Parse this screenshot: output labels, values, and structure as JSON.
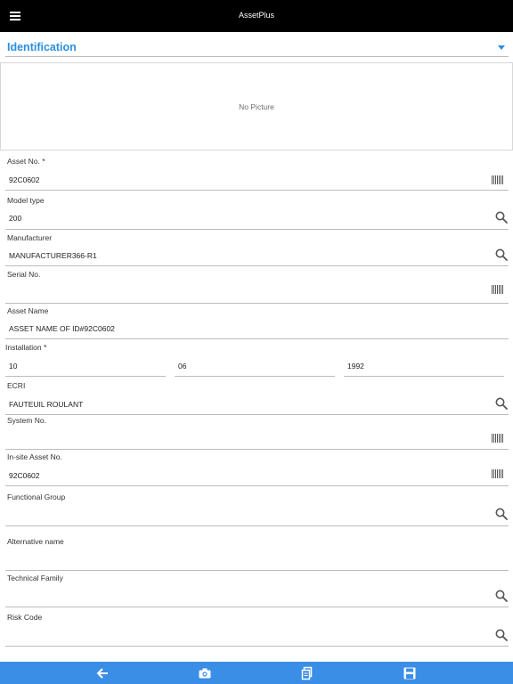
{
  "app": {
    "title": "AssetPlus"
  },
  "icons": {
    "menu": "hamburger-menu-icon",
    "barcode": "barcode-icon",
    "search": "search-icon",
    "back": "back-arrow-icon",
    "camera": "camera-icon",
    "copy": "copy-icon",
    "save": "save-icon"
  },
  "colors": {
    "accent": "#2b8fe0",
    "topbar": "#000000",
    "bottombar": "#3a8ee6"
  },
  "section": {
    "title": "Identification"
  },
  "picture": {
    "placeholder": "No Picture"
  },
  "fields": {
    "asset_no": {
      "label": "Asset No. *",
      "value": "92C0602"
    },
    "model_type": {
      "label": "Model type",
      "value": "200"
    },
    "manufacturer": {
      "label": "Manufacturer",
      "value": "MANUFACTURER366-R1"
    },
    "serial_no": {
      "label": "Serial No.",
      "value": ""
    },
    "asset_name": {
      "label": "Asset Name",
      "value": "ASSET NAME OF ID#92C0602"
    },
    "installation": {
      "label": "Installation *",
      "day": "10",
      "month": "06",
      "year": "1992"
    },
    "ecri": {
      "label": "ECRI",
      "value": "FAUTEUIL ROULANT"
    },
    "system_no": {
      "label": "System No.",
      "value": ""
    },
    "insite_asset_no": {
      "label": "In-site Asset No.",
      "value": "92C0602"
    },
    "functional_group": {
      "label": "Functional Group",
      "value": ""
    },
    "alternative_name": {
      "label": "Alternative name",
      "value": ""
    },
    "technical_family": {
      "label": "Technical Family",
      "value": ""
    },
    "risk_code": {
      "label": "Risk Code",
      "value": ""
    }
  }
}
